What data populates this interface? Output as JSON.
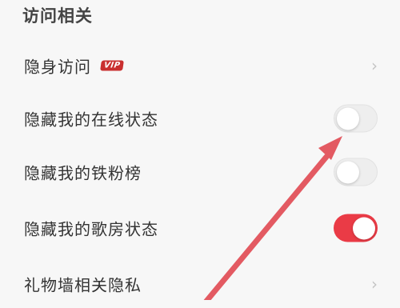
{
  "section": {
    "title": "访问相关"
  },
  "rows": [
    {
      "label": "隐身访问",
      "badge": "VIP",
      "control": "chevron",
      "chevron": "›"
    },
    {
      "label": "隐藏我的在线状态",
      "control": "toggle",
      "checked": false
    },
    {
      "label": "隐藏我的铁粉榜",
      "control": "toggle",
      "checked": false
    },
    {
      "label": "隐藏我的歌房状态",
      "control": "toggle",
      "checked": true
    },
    {
      "label": "礼物墙相关隐私",
      "control": "chevron",
      "chevron": "›"
    }
  ],
  "colors": {
    "accent": "#ea3b46",
    "annotation_arrow": "#e35a62",
    "badge": "#c92f2f"
  },
  "icons": {
    "chevron": "chevron-right-icon",
    "annotation": "arrow-annotation-icon"
  }
}
